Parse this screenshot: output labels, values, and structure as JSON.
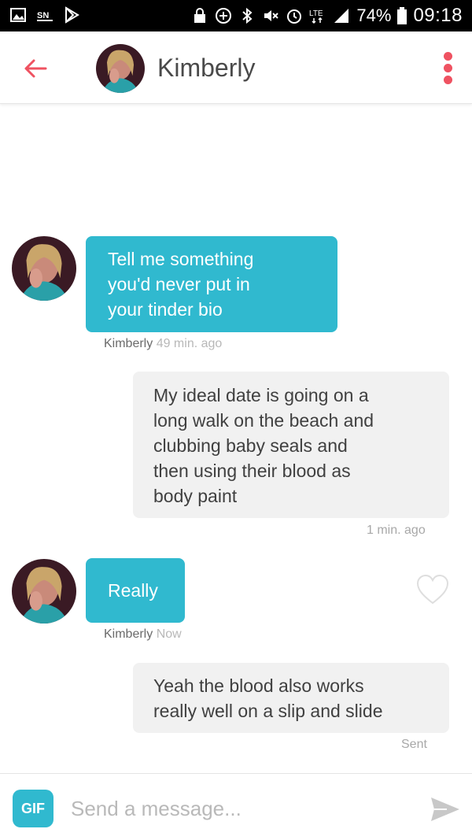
{
  "status_bar": {
    "time": "09:18",
    "battery_percent": "74%",
    "network": "LTE",
    "left_icons": [
      "gallery-icon",
      "sn-icon",
      "play-store-icon"
    ],
    "right_icons": [
      "lock-icon",
      "data-saver-icon",
      "bluetooth-icon",
      "mute-icon",
      "alarm-icon",
      "lte-icon",
      "signal-icon",
      "battery-icon"
    ]
  },
  "header": {
    "contact_name": "Kimberly",
    "back_icon": "back-arrow-icon",
    "menu_icon": "more-vert-icon",
    "accent_color": "#ef5261"
  },
  "messages": [
    {
      "direction": "incoming",
      "lines": [
        "Tell me something",
        "you'd never put in",
        "your tinder bio"
      ],
      "sender": "Kimberly",
      "time": "49 min. ago"
    },
    {
      "direction": "outgoing",
      "lines": [
        "My ideal date is going on a",
        "long walk on the beach and",
        "clubbing baby seals and",
        "then using their blood as",
        "body paint"
      ],
      "time": "1 min. ago"
    },
    {
      "direction": "incoming",
      "lines": [
        "Really"
      ],
      "sender": "Kimberly",
      "time": "Now"
    },
    {
      "direction": "outgoing",
      "lines": [
        "Yeah the blood also works",
        "really well on a slip and slide"
      ],
      "status": "Sent"
    }
  ],
  "composer": {
    "gif_label": "GIF",
    "placeholder": "Send a message...",
    "value": ""
  },
  "colors": {
    "incoming_bubble": "#30b9cf",
    "outgoing_bubble": "#f1f1f1",
    "accent": "#ef5261"
  }
}
